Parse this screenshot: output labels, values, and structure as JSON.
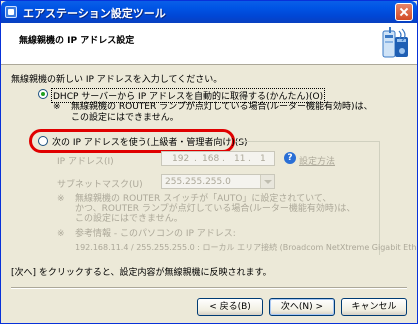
{
  "window": {
    "title": "エアステーション設定ツール"
  },
  "header": {
    "title": "無線親機の IP アドレス設定"
  },
  "intro": "無線親機の新しい IP アドレスを入力してください。",
  "option_dhcp": {
    "label": "DHCP サーバーから IP アドレスを自動的に取得する(かんたん)(O)",
    "selected": true,
    "note_mark": "※",
    "note_line1": "無線親機の ROUTER ランプが点灯している場合(ルーター機能有効時)は、",
    "note_line2": "この設定にはできません。"
  },
  "option_manual": {
    "label": "次の IP アドレスを使う(上級者・管理者向け)(S)",
    "selected": false
  },
  "ip": {
    "label": "IP アドレス(I)",
    "octets": [
      "192",
      "168",
      "11",
      "1"
    ],
    "dot": "."
  },
  "help_link": "設定方法",
  "subnet": {
    "label": "サブネットマスク(U)",
    "value": "255.255.255.0"
  },
  "note2": {
    "mark": "※",
    "line1": "無線親機の ROUTER スイッチが「AUTO」に設定されていて、",
    "line2": "かつ、ROUTER ランプが点灯している場合(ルーター機能有効時)は、",
    "line3": "この設定にはできません。"
  },
  "reference": {
    "mark": "※",
    "label": "参考情報 - このパソコンの IP アドレス:",
    "value": "192.168.11.4 / 255.255.255.0 : ローカル エリア接続 (Broadcom NetXtreme Gigabit Eth"
  },
  "status": "[次へ] をクリックすると、設定内容が無線親機に反映されます。",
  "buttons": {
    "back": "< 戻る(B)",
    "next": "次へ(N) >",
    "cancel": "キャンセル"
  },
  "colors": {
    "highlight": "#e00000",
    "titlebar": "#0055e5",
    "disabled_text": "#aca899"
  }
}
